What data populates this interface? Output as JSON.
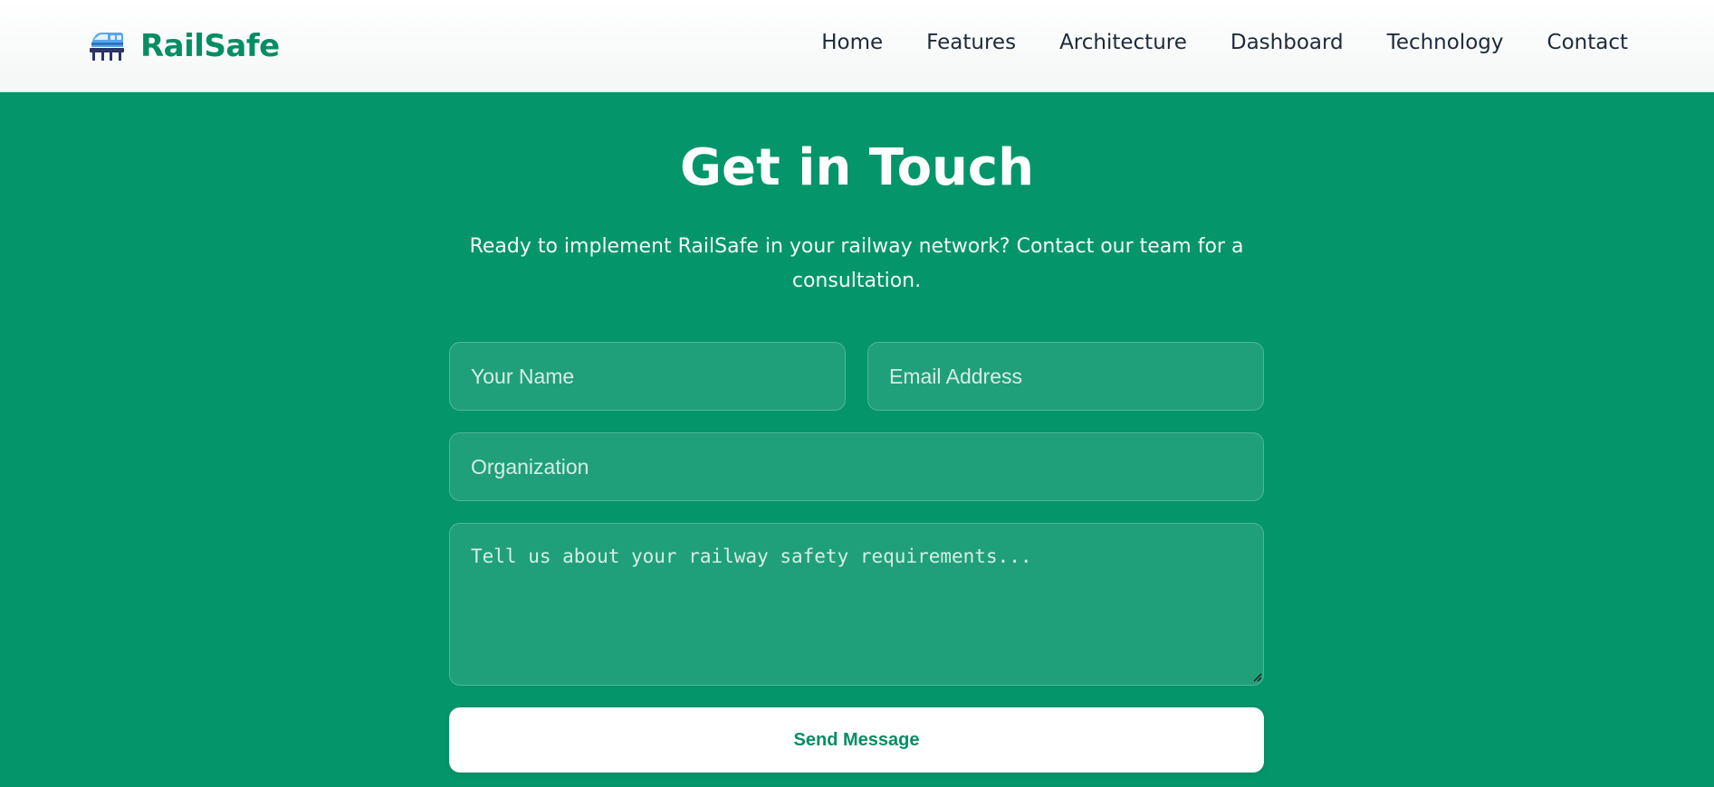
{
  "brand": {
    "name": "RailSafe",
    "icon": "train-icon",
    "color": "#058e63"
  },
  "nav": {
    "items": [
      {
        "label": "Home"
      },
      {
        "label": "Features"
      },
      {
        "label": "Architecture"
      },
      {
        "label": "Dashboard"
      },
      {
        "label": "Technology"
      },
      {
        "label": "Contact"
      }
    ]
  },
  "contact": {
    "title": "Get in Touch",
    "subtitle": "Ready to implement RailSafe in your railway network? Contact our team for a consultation.",
    "background": "#05956a",
    "form": {
      "name_placeholder": "Your Name",
      "email_placeholder": "Email Address",
      "organization_placeholder": "Organization",
      "message_placeholder": "Tell us about your railway safety requirements...",
      "submit_label": "Send Message"
    }
  }
}
